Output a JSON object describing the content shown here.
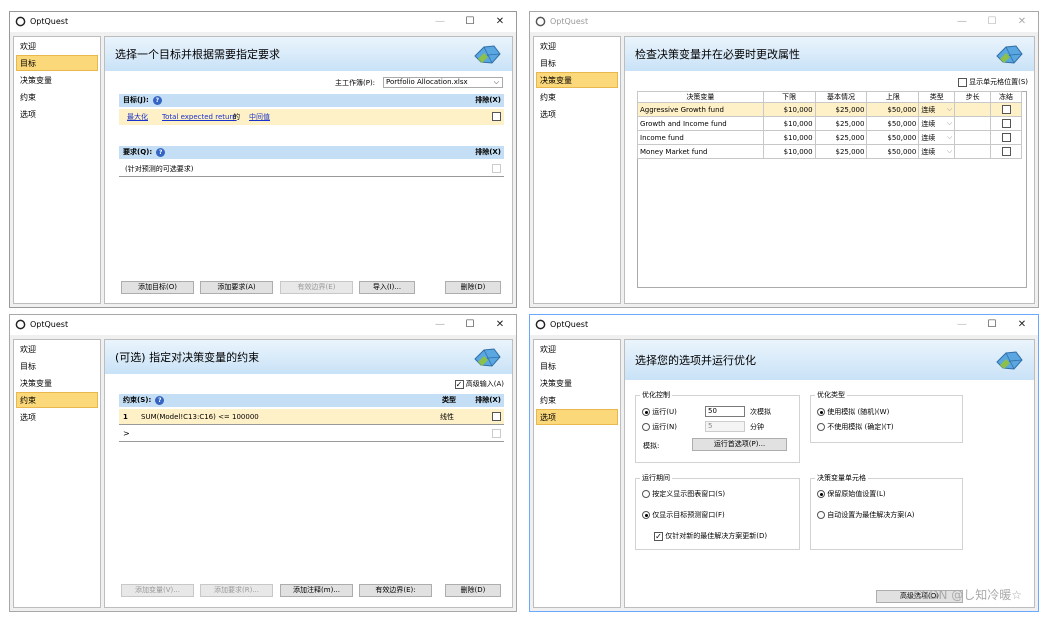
{
  "app": {
    "title": "OptQuest"
  },
  "nav": {
    "items": [
      "欢迎",
      "目标",
      "决策变量",
      "约束",
      "选项"
    ]
  },
  "w1": {
    "header": "选择一个目标并根据需要指定要求",
    "workbook_label": "主工作簿(P):",
    "workbook_value": "Portfolio Allocation.xlsx",
    "objectives_label": "目标(J):",
    "exclude_label": "排除(X)",
    "objective": {
      "sense": "最大化",
      "metric": "Total expected return",
      "of": "的",
      "stat": "中间值"
    },
    "requirements_label": "要求(Q):",
    "req_placeholder": "(针对预测的可选要求)",
    "buttons": {
      "add_obj": "添加目标(O)",
      "add_req": "添加要求(A)",
      "frontier": "有效边界(E)",
      "import": "导入(I)...",
      "delete": "删除(D)"
    }
  },
  "w2": {
    "header": "检查决策变量并在必要时更改属性",
    "show_cell_loc": "显示单元格位置(S)",
    "columns": [
      "决策变量",
      "下限",
      "基本情况",
      "上限",
      "类型",
      "步长",
      "冻结"
    ],
    "rows": [
      {
        "name": "Aggressive Growth fund",
        "low": "$10,000",
        "base": "$25,000",
        "high": "$50,000",
        "type": "连续"
      },
      {
        "name": "Growth and Income fund",
        "low": "$10,000",
        "base": "$25,000",
        "high": "$50,000",
        "type": "连续"
      },
      {
        "name": "Income fund",
        "low": "$10,000",
        "base": "$25,000",
        "high": "$50,000",
        "type": "连续"
      },
      {
        "name": "Money Market fund",
        "low": "$10,000",
        "base": "$25,000",
        "high": "$50,000",
        "type": "连续"
      }
    ]
  },
  "w3": {
    "header": "(可选) 指定对决策变量的约束",
    "advanced": "高级输入(A)",
    "constraints_label": "约束(S):",
    "type_label": "类型",
    "exclude_label": "排除(X)",
    "row": {
      "num": "1",
      "expr": "SUM(Model!C13:C16) <= 100000",
      "type": "线性"
    },
    "new_row": ">",
    "buttons": {
      "add_var": "添加变量(V)...",
      "add_req": "添加要求(R)...",
      "add_note": "添加注释(m)...",
      "frontier": "有效边界(E):",
      "delete": "删除(D)"
    }
  },
  "w4": {
    "header": "选择您的选项并运行优化",
    "opt_control": "优化控制",
    "run1": "运行(U)",
    "run1_val": "50",
    "run1_unit": "次模拟",
    "run2": "运行(N)",
    "run2_val": "5",
    "run2_unit": "分钟",
    "sim_label": "模拟:",
    "run_pref": "运行首选项(P)...",
    "opt_type": "优化类型",
    "use_sim": "使用模拟 (随机)(W)",
    "no_sim": "不使用模拟 (确定)(T)",
    "run_window": "运行期间",
    "custom": "按定义显示图表窗口(S)",
    "target_only": "仅显示目标预测窗口(F)",
    "only_new": "仅针对新的最佳解决方案更新(D)",
    "dv_cells": "决策变量单元格",
    "keep_orig": "保留原始值设置(L)",
    "auto_set": "自动设置为最佳解决方案(A)",
    "adv_btn": "高级选项(O)"
  },
  "watermark": "CSDN @し知冷暖☆"
}
